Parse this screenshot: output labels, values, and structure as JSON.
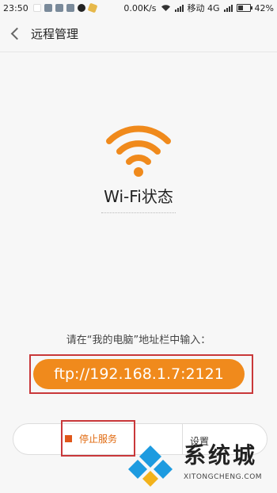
{
  "status_bar": {
    "time": "23:50",
    "speed": "0.00K/s",
    "carrier": "移动 4G",
    "battery": "42%"
  },
  "header": {
    "back_icon": "chevron-left-icon",
    "title": "远程管理"
  },
  "main": {
    "wifi_status_label": "Wi-Fi状态",
    "hint": "请在“我的电脑”地址栏中输入：",
    "ftp_address": "ftp://192.168.1.7:2121",
    "stop_service_label": "停止服务",
    "settings_label": "设置"
  },
  "watermark": {
    "brand": "系统城",
    "domain": "XITONGCHENG.COM"
  },
  "colors": {
    "accent_orange": "#f08a1c",
    "highlight_red": "#c9383a",
    "background": "#f7f7f7"
  }
}
